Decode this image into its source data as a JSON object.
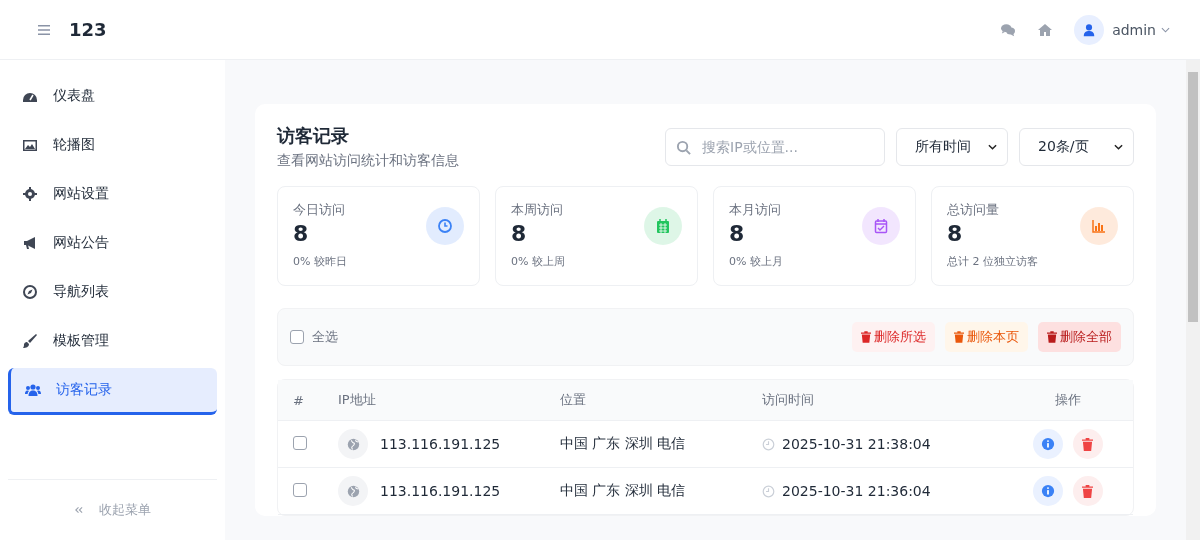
{
  "header": {
    "brand": "123",
    "user": "admin"
  },
  "sidebar": {
    "items": [
      {
        "label": "仪表盘",
        "selected": false
      },
      {
        "label": "轮播图",
        "selected": false
      },
      {
        "label": "网站设置",
        "selected": false
      },
      {
        "label": "网站公告",
        "selected": false
      },
      {
        "label": "导航列表",
        "selected": false
      },
      {
        "label": "模板管理",
        "selected": false
      },
      {
        "label": "访客记录",
        "selected": true
      }
    ],
    "collapse_label": "收起菜单"
  },
  "page": {
    "title": "访客记录",
    "subtitle": "查看网站访问统计和访客信息",
    "search": {
      "placeholder": "搜索IP或位置..."
    },
    "filters": [
      {
        "value": "所有时间"
      },
      {
        "value": "20条/页"
      }
    ]
  },
  "stats": [
    {
      "label": "今日访问",
      "value": "8",
      "note": "0% 较昨日",
      "color": "#3b82f6"
    },
    {
      "label": "本周访问",
      "value": "8",
      "note": "0% 较上周",
      "color": "#22c55e"
    },
    {
      "label": "本月访问",
      "value": "8",
      "note": "0% 较上月",
      "color": "#a855f7"
    },
    {
      "label": "总访问量",
      "value": "8",
      "note": "总计 2 位独立访客",
      "color": "#f97316"
    }
  ],
  "bulk": {
    "select_all": {
      "label": "全选",
      "checked": false
    },
    "buttons": [
      {
        "label": "删除所选",
        "kind": "soft"
      },
      {
        "label": "删除本页",
        "kind": "warning"
      },
      {
        "label": "删除全部",
        "kind": "danger"
      }
    ]
  },
  "table": {
    "columns": [
      "#",
      "IP地址",
      "位置",
      "访问时间",
      "操作"
    ],
    "rows": [
      {
        "checked": false,
        "ip": "113.116.191.125",
        "location": "中国 广东 深圳 电信",
        "time": "2025-10-31 21:38:04"
      },
      {
        "checked": false,
        "ip": "113.116.191.125",
        "location": "中国 广东 深圳 电信",
        "time": "2025-10-31 21:36:04"
      }
    ]
  }
}
